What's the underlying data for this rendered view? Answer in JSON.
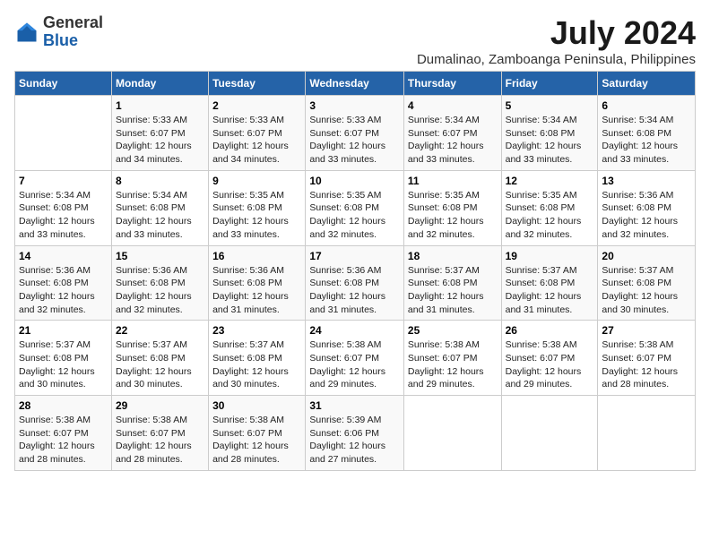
{
  "logo": {
    "general": "General",
    "blue": "Blue"
  },
  "title": "July 2024",
  "subtitle": "Dumalinao, Zamboanga Peninsula, Philippines",
  "headers": [
    "Sunday",
    "Monday",
    "Tuesday",
    "Wednesday",
    "Thursday",
    "Friday",
    "Saturday"
  ],
  "weeks": [
    [
      {
        "day": "",
        "sunrise": "",
        "sunset": "",
        "daylight": ""
      },
      {
        "day": "1",
        "sunrise": "Sunrise: 5:33 AM",
        "sunset": "Sunset: 6:07 PM",
        "daylight": "Daylight: 12 hours and 34 minutes."
      },
      {
        "day": "2",
        "sunrise": "Sunrise: 5:33 AM",
        "sunset": "Sunset: 6:07 PM",
        "daylight": "Daylight: 12 hours and 34 minutes."
      },
      {
        "day": "3",
        "sunrise": "Sunrise: 5:33 AM",
        "sunset": "Sunset: 6:07 PM",
        "daylight": "Daylight: 12 hours and 33 minutes."
      },
      {
        "day": "4",
        "sunrise": "Sunrise: 5:34 AM",
        "sunset": "Sunset: 6:07 PM",
        "daylight": "Daylight: 12 hours and 33 minutes."
      },
      {
        "day": "5",
        "sunrise": "Sunrise: 5:34 AM",
        "sunset": "Sunset: 6:08 PM",
        "daylight": "Daylight: 12 hours and 33 minutes."
      },
      {
        "day": "6",
        "sunrise": "Sunrise: 5:34 AM",
        "sunset": "Sunset: 6:08 PM",
        "daylight": "Daylight: 12 hours and 33 minutes."
      }
    ],
    [
      {
        "day": "7",
        "sunrise": "Sunrise: 5:34 AM",
        "sunset": "Sunset: 6:08 PM",
        "daylight": "Daylight: 12 hours and 33 minutes."
      },
      {
        "day": "8",
        "sunrise": "Sunrise: 5:34 AM",
        "sunset": "Sunset: 6:08 PM",
        "daylight": "Daylight: 12 hours and 33 minutes."
      },
      {
        "day": "9",
        "sunrise": "Sunrise: 5:35 AM",
        "sunset": "Sunset: 6:08 PM",
        "daylight": "Daylight: 12 hours and 33 minutes."
      },
      {
        "day": "10",
        "sunrise": "Sunrise: 5:35 AM",
        "sunset": "Sunset: 6:08 PM",
        "daylight": "Daylight: 12 hours and 32 minutes."
      },
      {
        "day": "11",
        "sunrise": "Sunrise: 5:35 AM",
        "sunset": "Sunset: 6:08 PM",
        "daylight": "Daylight: 12 hours and 32 minutes."
      },
      {
        "day": "12",
        "sunrise": "Sunrise: 5:35 AM",
        "sunset": "Sunset: 6:08 PM",
        "daylight": "Daylight: 12 hours and 32 minutes."
      },
      {
        "day": "13",
        "sunrise": "Sunrise: 5:36 AM",
        "sunset": "Sunset: 6:08 PM",
        "daylight": "Daylight: 12 hours and 32 minutes."
      }
    ],
    [
      {
        "day": "14",
        "sunrise": "Sunrise: 5:36 AM",
        "sunset": "Sunset: 6:08 PM",
        "daylight": "Daylight: 12 hours and 32 minutes."
      },
      {
        "day": "15",
        "sunrise": "Sunrise: 5:36 AM",
        "sunset": "Sunset: 6:08 PM",
        "daylight": "Daylight: 12 hours and 32 minutes."
      },
      {
        "day": "16",
        "sunrise": "Sunrise: 5:36 AM",
        "sunset": "Sunset: 6:08 PM",
        "daylight": "Daylight: 12 hours and 31 minutes."
      },
      {
        "day": "17",
        "sunrise": "Sunrise: 5:36 AM",
        "sunset": "Sunset: 6:08 PM",
        "daylight": "Daylight: 12 hours and 31 minutes."
      },
      {
        "day": "18",
        "sunrise": "Sunrise: 5:37 AM",
        "sunset": "Sunset: 6:08 PM",
        "daylight": "Daylight: 12 hours and 31 minutes."
      },
      {
        "day": "19",
        "sunrise": "Sunrise: 5:37 AM",
        "sunset": "Sunset: 6:08 PM",
        "daylight": "Daylight: 12 hours and 31 minutes."
      },
      {
        "day": "20",
        "sunrise": "Sunrise: 5:37 AM",
        "sunset": "Sunset: 6:08 PM",
        "daylight": "Daylight: 12 hours and 30 minutes."
      }
    ],
    [
      {
        "day": "21",
        "sunrise": "Sunrise: 5:37 AM",
        "sunset": "Sunset: 6:08 PM",
        "daylight": "Daylight: 12 hours and 30 minutes."
      },
      {
        "day": "22",
        "sunrise": "Sunrise: 5:37 AM",
        "sunset": "Sunset: 6:08 PM",
        "daylight": "Daylight: 12 hours and 30 minutes."
      },
      {
        "day": "23",
        "sunrise": "Sunrise: 5:37 AM",
        "sunset": "Sunset: 6:08 PM",
        "daylight": "Daylight: 12 hours and 30 minutes."
      },
      {
        "day": "24",
        "sunrise": "Sunrise: 5:38 AM",
        "sunset": "Sunset: 6:07 PM",
        "daylight": "Daylight: 12 hours and 29 minutes."
      },
      {
        "day": "25",
        "sunrise": "Sunrise: 5:38 AM",
        "sunset": "Sunset: 6:07 PM",
        "daylight": "Daylight: 12 hours and 29 minutes."
      },
      {
        "day": "26",
        "sunrise": "Sunrise: 5:38 AM",
        "sunset": "Sunset: 6:07 PM",
        "daylight": "Daylight: 12 hours and 29 minutes."
      },
      {
        "day": "27",
        "sunrise": "Sunrise: 5:38 AM",
        "sunset": "Sunset: 6:07 PM",
        "daylight": "Daylight: 12 hours and 28 minutes."
      }
    ],
    [
      {
        "day": "28",
        "sunrise": "Sunrise: 5:38 AM",
        "sunset": "Sunset: 6:07 PM",
        "daylight": "Daylight: 12 hours and 28 minutes."
      },
      {
        "day": "29",
        "sunrise": "Sunrise: 5:38 AM",
        "sunset": "Sunset: 6:07 PM",
        "daylight": "Daylight: 12 hours and 28 minutes."
      },
      {
        "day": "30",
        "sunrise": "Sunrise: 5:38 AM",
        "sunset": "Sunset: 6:07 PM",
        "daylight": "Daylight: 12 hours and 28 minutes."
      },
      {
        "day": "31",
        "sunrise": "Sunrise: 5:39 AM",
        "sunset": "Sunset: 6:06 PM",
        "daylight": "Daylight: 12 hours and 27 minutes."
      },
      {
        "day": "",
        "sunrise": "",
        "sunset": "",
        "daylight": ""
      },
      {
        "day": "",
        "sunrise": "",
        "sunset": "",
        "daylight": ""
      },
      {
        "day": "",
        "sunrise": "",
        "sunset": "",
        "daylight": ""
      }
    ]
  ]
}
